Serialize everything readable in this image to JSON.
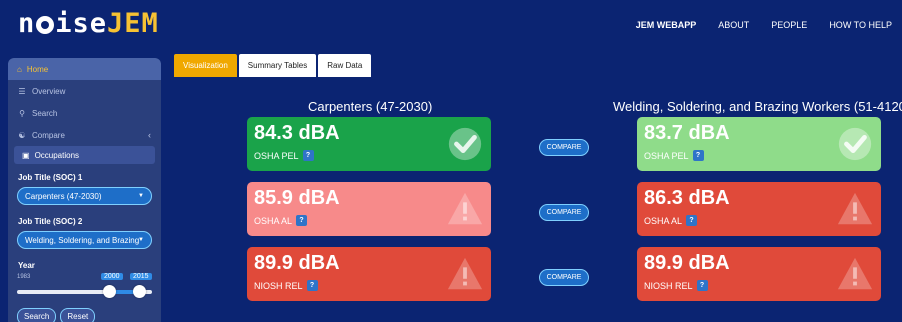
{
  "brand": {
    "logo_left": "n",
    "logo_mid": "ise",
    "logo_right": "JEM"
  },
  "nav": {
    "items": [
      "JEM WEBAPP",
      "ABOUT",
      "PEOPLE",
      "HOW TO HELP"
    ]
  },
  "sidebar": {
    "home": "Home",
    "overview": "Overview",
    "search": "Search",
    "compare": "Compare",
    "occupations": "Occupations",
    "job1_label": "Job Title (SOC) 1",
    "job1_value": "Carpenters (47-2030)",
    "job2_label": "Job Title (SOC) 2",
    "job2_value": "Welding, Soldering, and Brazing",
    "year_label": "Year",
    "year_min": "1983",
    "year_from": "2000",
    "year_to": "2015",
    "search_btn": "Search",
    "reset_btn": "Reset"
  },
  "tabs": [
    "Visualization",
    "Summary Tables",
    "Raw Data"
  ],
  "compare_label": "COMPARE",
  "left": {
    "title": "Carpenters (47-2030)",
    "cards": [
      {
        "value": "84.3 dBA",
        "label": "OSHA PEL",
        "status": "ok",
        "color": "#1aa34a"
      },
      {
        "value": "85.9 dBA",
        "label": "OSHA AL",
        "status": "warn",
        "color": "#f78a8a"
      },
      {
        "value": "89.9 dBA",
        "label": "NIOSH REL",
        "status": "warn",
        "color": "#e04a3a"
      }
    ]
  },
  "right": {
    "title": "Welding, Soldering, and Brazing Workers (51-4120",
    "cards": [
      {
        "value": "83.7 dBA",
        "label": "OSHA PEL",
        "status": "ok",
        "color": "#8fdc8a"
      },
      {
        "value": "86.3 dBA",
        "label": "OSHA AL",
        "status": "warn",
        "color": "#e04a3a"
      },
      {
        "value": "89.9 dBA",
        "label": "NIOSH REL",
        "status": "warn",
        "color": "#e04a3a"
      }
    ]
  },
  "help_badge": "?",
  "colors": {
    "navy": "#0b2472",
    "accent": "#f7c233",
    "tab_active": "#f0a800"
  }
}
